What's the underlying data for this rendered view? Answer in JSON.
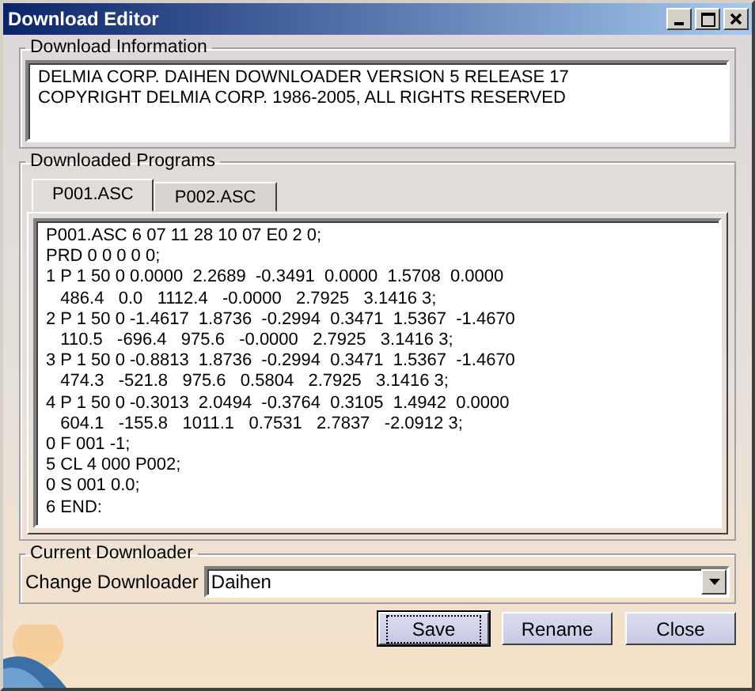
{
  "window": {
    "title": "Download Editor"
  },
  "download_information": {
    "label": "Download Information",
    "lines": [
      "DELMIA CORP. DAIHEN DOWNLOADER VERSION 5 RELEASE 17",
      "COPYRIGHT DELMIA CORP. 1986-2005, ALL RIGHTS RESERVED"
    ]
  },
  "downloaded_programs": {
    "label": "Downloaded Programs",
    "tabs": [
      {
        "label": "P001.ASC",
        "selected": true
      },
      {
        "label": "P002.ASC",
        "selected": false
      }
    ],
    "lines": [
      "P001.ASC 6 07 11 28 10 07 E0 2 0;",
      "PRD 0 0 0 0 0;",
      "1 P 1 50 0 0.0000  2.2689  -0.3491  0.0000  1.5708  0.0000",
      "   486.4   0.0   1112.4   -0.0000   2.7925   3.1416 3;",
      "2 P 1 50 0 -1.4617  1.8736  -0.2994  0.3471  1.5367  -1.4670",
      "   110.5   -696.4   975.6   -0.0000   2.7925   3.1416 3;",
      "3 P 1 50 0 -0.8813  1.8736  -0.2994  0.3471  1.5367  -1.4670",
      "   474.3   -521.8   975.6   0.5804   2.7925   3.1416 3;",
      "4 P 1 50 0 -0.3013  2.0494  -0.3764  0.3105  1.4942  0.0000",
      "   604.1   -155.8   1011.1   0.7531   2.7837   -2.0912 3;",
      "0 F 001 -1;",
      "5 CL 4 000 P002;",
      "0 S 001 0.0;",
      "6 END:"
    ]
  },
  "current_downloader": {
    "label": "Current Downloader",
    "field_label": "Change Downloader",
    "value": "Daihen"
  },
  "buttons": [
    {
      "label": "Save",
      "selected": true
    },
    {
      "label": "Rename",
      "selected": false
    },
    {
      "label": "Close",
      "selected": false
    }
  ]
}
